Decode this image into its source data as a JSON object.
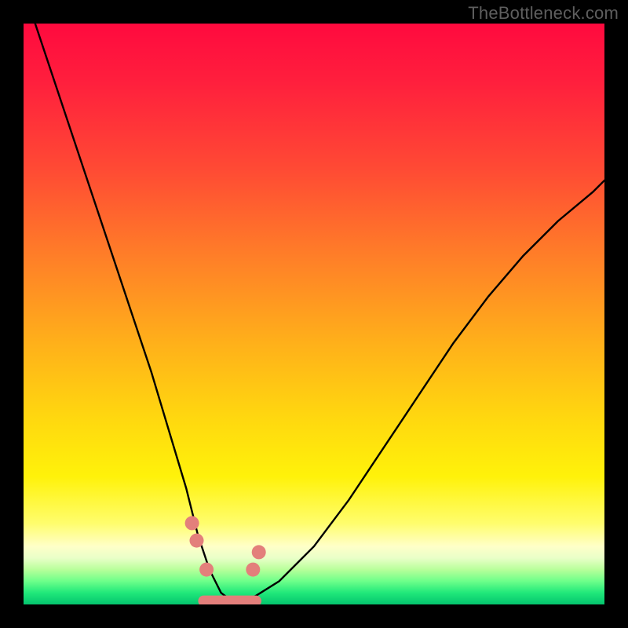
{
  "watermark": {
    "text": "TheBottleneck.com"
  },
  "gradient": {
    "stops": [
      {
        "pct": 0,
        "color": "#ff0a3e"
      },
      {
        "pct": 25,
        "color": "#ff4a34"
      },
      {
        "pct": 55,
        "color": "#ffb01a"
      },
      {
        "pct": 78,
        "color": "#fff20a"
      },
      {
        "pct": 92,
        "color": "#e9ffc8"
      },
      {
        "pct": 100,
        "color": "#04c46e"
      }
    ]
  },
  "chart_data": {
    "type": "line",
    "title": "",
    "xlabel": "",
    "ylabel": "",
    "xlim": [
      0,
      100
    ],
    "ylim": [
      0,
      100
    ],
    "series": [
      {
        "name": "main-curve",
        "x": [
          2,
          6,
          10,
          14,
          18,
          22,
          25,
          28,
          30,
          32,
          34,
          36,
          38,
          40,
          44,
          50,
          56,
          62,
          68,
          74,
          80,
          86,
          92,
          98,
          100
        ],
        "y": [
          100,
          88,
          76,
          64,
          52,
          40,
          30,
          20,
          12,
          6,
          2,
          0.5,
          0.5,
          1.5,
          4,
          10,
          18,
          27,
          36,
          45,
          53,
          60,
          66,
          71,
          73
        ]
      }
    ],
    "markers": {
      "name": "salmon-dots",
      "color": "#e37f7b",
      "points": [
        {
          "x": 29.0,
          "y": 14.0
        },
        {
          "x": 29.8,
          "y": 11.0
        },
        {
          "x": 31.5,
          "y": 6.0
        },
        {
          "x": 39.5,
          "y": 6.0
        },
        {
          "x": 40.5,
          "y": 9.0
        }
      ],
      "bottom_band": {
        "x_start": 31.0,
        "x_end": 40.0,
        "y": 0.6
      }
    }
  }
}
